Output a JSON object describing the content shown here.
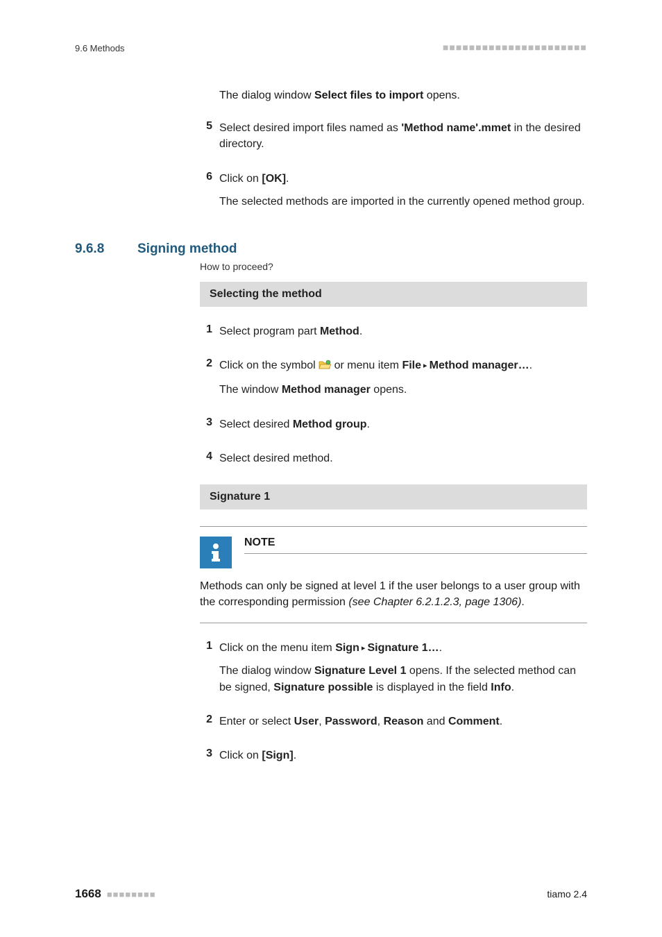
{
  "header": {
    "left": "9.6 Methods",
    "dots": "■■■■■■■■■■■■■■■■■■■■■■"
  },
  "intro_line": {
    "pre": "The dialog window ",
    "bold": "Select files to import",
    "post": " opens."
  },
  "step5": {
    "num": "5",
    "pre": "Select desired import files named as ",
    "bold": "'Method name'.mmet",
    "post": " in the desired directory."
  },
  "step6": {
    "num": "6",
    "line1_pre": "Click on ",
    "line1_bold": "[OK]",
    "line1_post": ".",
    "line2": "The selected methods are imported in the currently opened method group."
  },
  "section": {
    "num": "9.6.8",
    "title": "Signing method",
    "subintro": "How to proceed?"
  },
  "sel_bar": "Selecting the method",
  "sel1": {
    "num": "1",
    "pre": "Select program part ",
    "bold": "Method",
    "post": "."
  },
  "sel2": {
    "num": "2",
    "pre": "Click on the symbol ",
    "mid": " or menu item ",
    "bold1": "File",
    "tri": " ▸ ",
    "bold2": "Method manager…",
    "post": ".",
    "line2_pre": "The window ",
    "line2_bold": "Method manager",
    "line2_post": " opens."
  },
  "sel3": {
    "num": "3",
    "pre": "Select desired ",
    "bold": "Method group",
    "post": "."
  },
  "sel4": {
    "num": "4",
    "text": "Select desired method."
  },
  "sig_bar": "Signature 1",
  "note": {
    "title": "NOTE",
    "body_pre": "Methods can only be signed at level 1 if the user belongs to a user group with the corresponding permission ",
    "body_italic": "(see Chapter 6.2.1.2.3, page 1306)",
    "body_post": "."
  },
  "sig1": {
    "num": "1",
    "l1_pre": "Click on the menu item ",
    "l1_b1": "Sign",
    "l1_tri": " ▸ ",
    "l1_b2": "Signature 1…",
    "l1_post": ".",
    "l2_pre": "The dialog window ",
    "l2_b1": "Signature Level 1",
    "l2_mid": " opens. If the selected method can be signed, ",
    "l2_b2": "Signature possible",
    "l2_mid2": " is displayed in the field ",
    "l2_b3": "Info",
    "l2_post": "."
  },
  "sig2": {
    "num": "2",
    "pre": "Enter or select ",
    "b1": "User",
    "c1": ", ",
    "b2": "Password",
    "c2": ", ",
    "b3": "Reason",
    "c3": " and ",
    "b4": "Comment",
    "post": "."
  },
  "sig3": {
    "num": "3",
    "pre": "Click on ",
    "bold": "[Sign]",
    "post": "."
  },
  "footer": {
    "page": "1668",
    "dots": "■■■■■■■■",
    "right": "tiamo 2.4"
  }
}
